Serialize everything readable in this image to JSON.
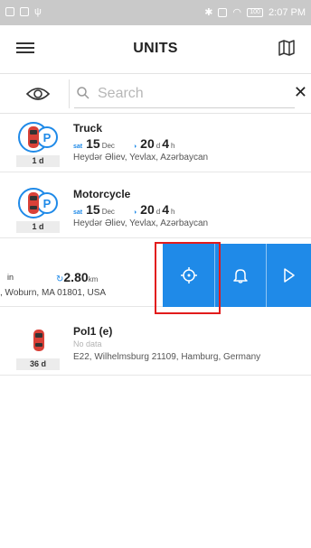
{
  "status_bar": {
    "time": "2:07 PM",
    "battery": "100"
  },
  "header": {
    "title": "UNITS"
  },
  "search": {
    "placeholder": "Search",
    "value": ""
  },
  "colors": {
    "accent": "#1f8ae8",
    "highlight": "#e21b1b"
  },
  "units": [
    {
      "name": "Truck",
      "satellites": "15",
      "sat_unit": "Dec",
      "duration_d": "20",
      "duration_h": "4",
      "address": "Heydər Əliev, Yevlax, Azərbaycan",
      "age": "1 d"
    },
    {
      "name": "Motorcycle",
      "satellites": "15",
      "sat_unit": "Dec",
      "duration_d": "20",
      "duration_h": "4",
      "address": "Heydər Əliev, Yevlax, Azərbaycan",
      "age": "1 d"
    },
    {
      "name": "Pol1 (e)",
      "status": "No data",
      "address": "E22, Wilhelmsburg 21109, Hamburg, Germany",
      "age": "36 d"
    }
  ],
  "swiped_unit": {
    "fragment": "in",
    "speed": "2.80",
    "speed_unit": "km",
    "address": ", Woburn, MA 01801, USA"
  },
  "actions": [
    "locate-icon",
    "bell-icon",
    "play-icon"
  ]
}
